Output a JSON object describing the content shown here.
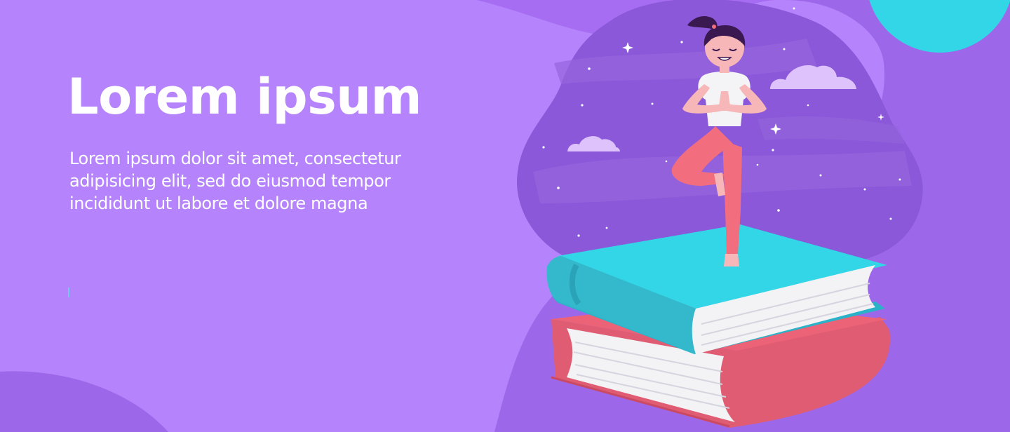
{
  "hero": {
    "title": "Lorem ipsum",
    "body_lines": [
      "Lorem ipsum dolor sit amet, consectetur",
      "adipisicing elit, sed do eiusmod tempor",
      "incididunt ut labore et dolore magna"
    ]
  },
  "colors": {
    "background": "#b583fb",
    "blob_dark": "#8a58d8",
    "blob_mid": "#9d67e9",
    "accent_cyan": "#33d6e6",
    "book_red": "#ec6378",
    "shirt_white": "#f4f4f6",
    "leggings_pink": "#f26e7e",
    "skin": "#f7b7b8",
    "hair": "#3a1850",
    "cloud": "#dec2fb"
  },
  "illustration": {
    "subject": "woman-doing-yoga-tree-pose-on-book-stack",
    "icons": [
      "cloud-icon",
      "sparkle-icon",
      "star-icon",
      "book-icon"
    ]
  }
}
